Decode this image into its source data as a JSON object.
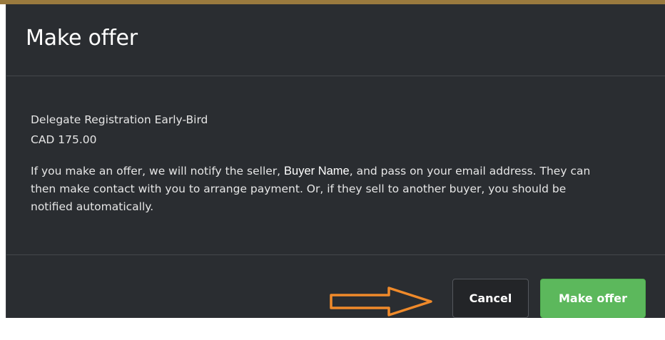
{
  "modal": {
    "title": "Make offer",
    "item_name": "Delegate Registration Early-Bird",
    "item_price": "CAD 175.00",
    "message_before": "If you make an offer, we will notify the seller, ",
    "seller_name": "Buyer Name",
    "message_after": ", and pass on your email address. They can then make contact with you to arrange payment. Or, if they sell to another buyer, you should be notified automatically.",
    "cancel_label": "Cancel",
    "submit_label": "Make offer"
  },
  "annotation": {
    "icon": "right-arrow-icon",
    "color": "#f08a2a"
  },
  "colors": {
    "modal_background": "#2a2d31",
    "submit_button": "#5cb85c",
    "cancel_button": "#232528"
  }
}
